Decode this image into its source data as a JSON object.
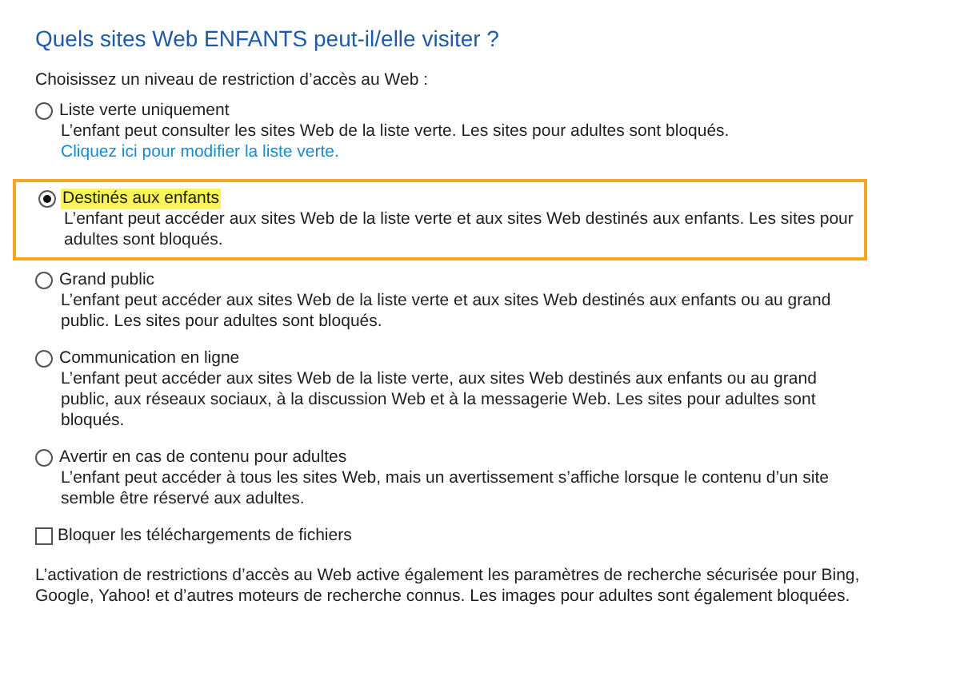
{
  "title": "Quels sites Web ENFANTS peut-il/elle visiter ?",
  "prompt": "Choisissez un niveau de restriction d’accès au Web :",
  "options": [
    {
      "label": "Liste verte uniquement",
      "description": "L’enfant peut consulter les sites Web de la liste verte. Les sites pour adultes sont bloqués.",
      "link": "Cliquez ici pour modifier la liste verte.",
      "selected": false
    },
    {
      "label": "Destinés aux enfants",
      "description": "L’enfant peut accéder aux sites Web de la liste verte et aux sites Web destinés aux enfants. Les sites pour adultes sont bloqués.",
      "selected": true
    },
    {
      "label": "Grand public",
      "description": "L’enfant peut accéder aux sites Web de la liste verte et aux sites Web destinés aux enfants ou au grand public. Les sites pour adultes sont bloqués.",
      "selected": false
    },
    {
      "label": "Communication en ligne",
      "description": "L’enfant peut accéder aux sites Web de la liste verte, aux sites Web destinés aux enfants ou au grand public, aux réseaux sociaux, à la discussion Web et à la messagerie Web. Les sites pour adultes sont bloqués.",
      "selected": false
    },
    {
      "label": "Avertir en cas de contenu pour adultes",
      "description": "L’enfant peut accéder à tous les sites Web, mais un avertissement s’affiche lorsque le contenu d’un site semble être réservé aux adultes.",
      "selected": false
    }
  ],
  "download_block": {
    "label": "Bloquer les téléchargements de fichiers",
    "checked": false
  },
  "footnote": "L’activation de restrictions d’accès au Web active également les paramètres de recherche sécurisée pour Bing, Google, Yahoo! et d’autres moteurs de recherche connus. Les images pour adultes sont également bloquées."
}
